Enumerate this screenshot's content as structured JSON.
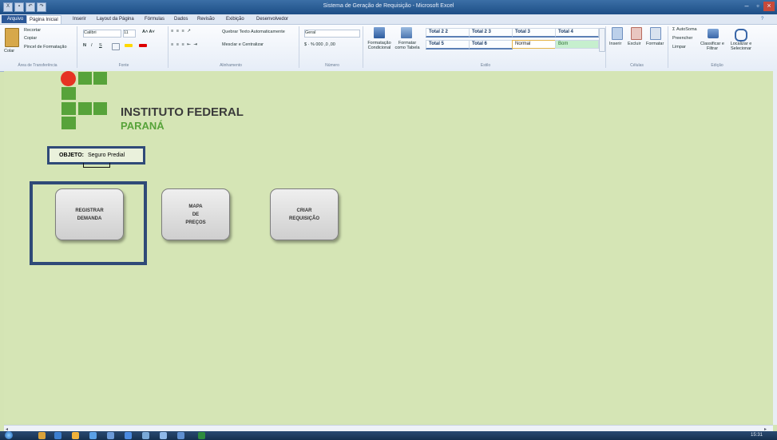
{
  "window": {
    "title": "Sistema de Geração de Requisição - Microsoft Excel"
  },
  "ribbon_tabs": [
    "Arquivo",
    "Página Inicial",
    "Inserir",
    "Layout da Página",
    "Fórmulas",
    "Dados",
    "Revisão",
    "Exibição",
    "Desenvolvedor"
  ],
  "clipboard": {
    "paste": "Colar",
    "cut": "Recortar",
    "copy": "Copiar",
    "format_painter": "Pincel de Formatação",
    "group": "Área de Transferência"
  },
  "font": {
    "name": "Calibri",
    "size": "11",
    "group": "Fonte",
    "bold": "N",
    "italic": "I",
    "underline": "S"
  },
  "alignment": {
    "wrap": "Quebrar Texto Automaticamente",
    "merge": "Mesclar e Centralizar",
    "group": "Alinhamento"
  },
  "number": {
    "format": "Geral",
    "group": "Número"
  },
  "styles": {
    "conditional": "Formatação Condicional",
    "as_table": "Formatar como Tabela",
    "group": "Estilo",
    "cells": [
      "Total 2 2",
      "Total 2 3",
      "Total 3",
      "Total 4",
      "Total 5",
      "Total 6",
      "Normal",
      "Bom"
    ]
  },
  "cells_group": {
    "insert": "Inserir",
    "delete": "Excluir",
    "format": "Formatar",
    "group": "Células"
  },
  "editing": {
    "autosum": "AutoSoma",
    "fill": "Preencher",
    "clear": "Limpar",
    "sort": "Classificar e Filtrar",
    "find": "Localizar e Selecionar",
    "group": "Edição"
  },
  "logo": {
    "line1": "INSTITUTO FEDERAL",
    "line2": "PARANÁ",
    "accent": "#e63323",
    "green": "#57a33a"
  },
  "objeto": {
    "label": "OBJETO:",
    "value": "Seguro Predial"
  },
  "buttons": {
    "registrar": [
      "REGISTRAR",
      "DEMANDA"
    ],
    "mapa": [
      "MAPA",
      "DE",
      "PREÇOS"
    ],
    "criar": [
      "CRIAR",
      "REQUISIÇÃO"
    ]
  },
  "taskbar": {
    "clock": "15:31"
  }
}
